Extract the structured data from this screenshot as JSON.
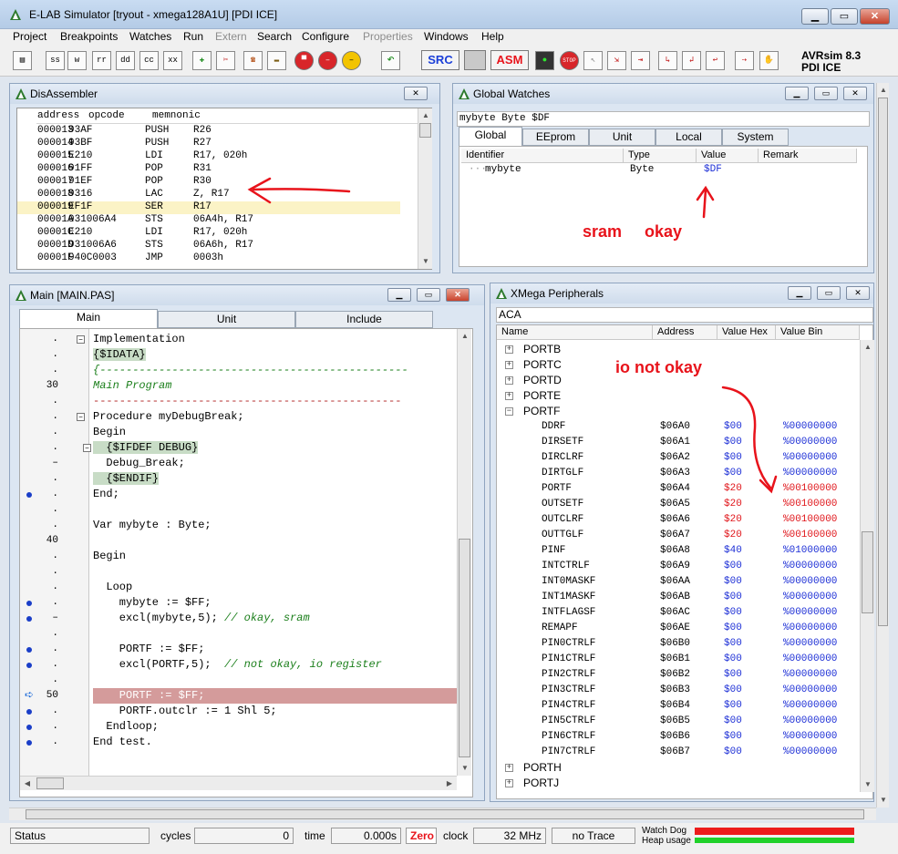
{
  "window": {
    "title": "E-LAB Simulator [tryout - xmega128A1U] [PDI ICE]",
    "min": "▁",
    "max": "▭",
    "close": "✕"
  },
  "menu": [
    {
      "label": "Project",
      "enabled": true
    },
    {
      "label": "Breakpoints",
      "enabled": true
    },
    {
      "label": "Watches",
      "enabled": true
    },
    {
      "label": "Run",
      "enabled": true
    },
    {
      "label": "Extern",
      "enabled": false
    },
    {
      "label": "Search",
      "enabled": true
    },
    {
      "label": "Configure",
      "enabled": true
    },
    {
      "label": "Properties",
      "enabled": false
    },
    {
      "label": "Windows",
      "enabled": true
    },
    {
      "label": "Help",
      "enabled": true
    }
  ],
  "toolbar": {
    "btn_ss": "ss",
    "btn_w": "w",
    "btn_rr": "rr",
    "btn_dd": "dd",
    "btn_cc": "cc",
    "btn_xx": "xx",
    "src": "SRC",
    "asm": "ASM",
    "stop": "STOP",
    "product": "AVRsim 8.3",
    "mode": "PDI ICE"
  },
  "disasm": {
    "title": "DisAssembler",
    "header": {
      "address": "address",
      "opcode": "opcode",
      "mnemonic": "memnonic"
    },
    "rows": [
      {
        "addr": "000013",
        "op": "93AF",
        "mn": "PUSH",
        "args": "R26"
      },
      {
        "addr": "000014",
        "op": "93BF",
        "mn": "PUSH",
        "args": "R27"
      },
      {
        "addr": "000015",
        "op": "E210",
        "mn": "LDI",
        "args": "R17, 020h"
      },
      {
        "addr": "000016",
        "op": "91FF",
        "mn": "POP",
        "args": "R31"
      },
      {
        "addr": "000017",
        "op": "91EF",
        "mn": "POP",
        "args": "R30"
      },
      {
        "addr": "000018",
        "op": "9316",
        "mn": "LAC",
        "args": "Z, R17"
      },
      {
        "addr": "000019",
        "op": "EF1F",
        "mn": "SER",
        "args": "R17",
        "current": true
      },
      {
        "addr": "00001A",
        "op": "931006A4",
        "mn": "STS",
        "args": "06A4h, R17"
      },
      {
        "addr": "00001C",
        "op": "E210",
        "mn": "LDI",
        "args": "R17, 020h"
      },
      {
        "addr": "00001D",
        "op": "931006A6",
        "mn": "STS",
        "args": "06A6h, R17"
      },
      {
        "addr": "00001F",
        "op": "940C0003",
        "mn": "JMP",
        "args": "0003h"
      }
    ]
  },
  "watches": {
    "title": "Global Watches",
    "expression": "mybyte Byte $DF",
    "tabs": [
      "Global",
      "EEprom",
      "Unit",
      "Local",
      "System"
    ],
    "columns": [
      "Identifier",
      "Type",
      "Value",
      "Remark"
    ],
    "rows": [
      {
        "id": "mybyte",
        "type": "Byte",
        "value": "$DF",
        "remark": ""
      }
    ]
  },
  "main": {
    "title": "Main [MAIN.PAS]",
    "tabs": [
      "Main",
      "Unit",
      "Include"
    ]
  },
  "periph": {
    "title": "XMega Peripherals",
    "select": "ACA",
    "columns": [
      "Name",
      "Address",
      "Value Hex",
      "Value Bin"
    ],
    "groups_top": [
      "PORTB",
      "PORTC",
      "PORTD",
      "PORTE"
    ],
    "open_group": "PORTF",
    "rows": [
      {
        "n": "DDRF",
        "a": "$06A0",
        "h": "$00",
        "b": "%00000000",
        "red": false
      },
      {
        "n": "DIRSETF",
        "a": "$06A1",
        "h": "$00",
        "b": "%00000000",
        "red": false
      },
      {
        "n": "DIRCLRF",
        "a": "$06A2",
        "h": "$00",
        "b": "%00000000",
        "red": false
      },
      {
        "n": "DIRTGLF",
        "a": "$06A3",
        "h": "$00",
        "b": "%00000000",
        "red": false
      },
      {
        "n": "PORTF",
        "a": "$06A4",
        "h": "$20",
        "b": "%00100000",
        "red": true
      },
      {
        "n": "OUTSETF",
        "a": "$06A5",
        "h": "$20",
        "b": "%00100000",
        "red": true
      },
      {
        "n": "OUTCLRF",
        "a": "$06A6",
        "h": "$20",
        "b": "%00100000",
        "red": true
      },
      {
        "n": "OUTTGLF",
        "a": "$06A7",
        "h": "$20",
        "b": "%00100000",
        "red": true
      },
      {
        "n": "PINF",
        "a": "$06A8",
        "h": "$40",
        "b": "%01000000",
        "red": false
      },
      {
        "n": "INTCTRLF",
        "a": "$06A9",
        "h": "$00",
        "b": "%00000000",
        "red": false
      },
      {
        "n": "INT0MASKF",
        "a": "$06AA",
        "h": "$00",
        "b": "%00000000",
        "red": false
      },
      {
        "n": "INT1MASKF",
        "a": "$06AB",
        "h": "$00",
        "b": "%00000000",
        "red": false
      },
      {
        "n": "INTFLAGSF",
        "a": "$06AC",
        "h": "$00",
        "b": "%00000000",
        "red": false
      },
      {
        "n": "REMAPF",
        "a": "$06AE",
        "h": "$00",
        "b": "%00000000",
        "red": false
      },
      {
        "n": "PIN0CTRLF",
        "a": "$06B0",
        "h": "$00",
        "b": "%00000000",
        "red": false
      },
      {
        "n": "PIN1CTRLF",
        "a": "$06B1",
        "h": "$00",
        "b": "%00000000",
        "red": false
      },
      {
        "n": "PIN2CTRLF",
        "a": "$06B2",
        "h": "$00",
        "b": "%00000000",
        "red": false
      },
      {
        "n": "PIN3CTRLF",
        "a": "$06B3",
        "h": "$00",
        "b": "%00000000",
        "red": false
      },
      {
        "n": "PIN4CTRLF",
        "a": "$06B4",
        "h": "$00",
        "b": "%00000000",
        "red": false
      },
      {
        "n": "PIN5CTRLF",
        "a": "$06B5",
        "h": "$00",
        "b": "%00000000",
        "red": false
      },
      {
        "n": "PIN6CTRLF",
        "a": "$06B6",
        "h": "$00",
        "b": "%00000000",
        "red": false
      },
      {
        "n": "PIN7CTRLF",
        "a": "$06B7",
        "h": "$00",
        "b": "%00000000",
        "red": false
      }
    ],
    "groups_bottom": [
      "PORTH",
      "PORTJ"
    ]
  },
  "annotations": {
    "sram": "sram",
    "okay": "okay",
    "io": "io not okay"
  },
  "status": {
    "status": "Status",
    "cycles_label": "cycles",
    "cycles": "0",
    "time_label": "time",
    "time": "0.000s",
    "zero": "Zero",
    "clock_label": "clock",
    "clock": "32 MHz",
    "trace": "no Trace",
    "watchdog": "Watch Dog",
    "heap": "Heap usage"
  },
  "colors": {
    "accent_red": "#e8131b",
    "value_blue": "#1d2fd6",
    "current_line": "#d49b9b",
    "heap_green": "#1fd12a"
  }
}
